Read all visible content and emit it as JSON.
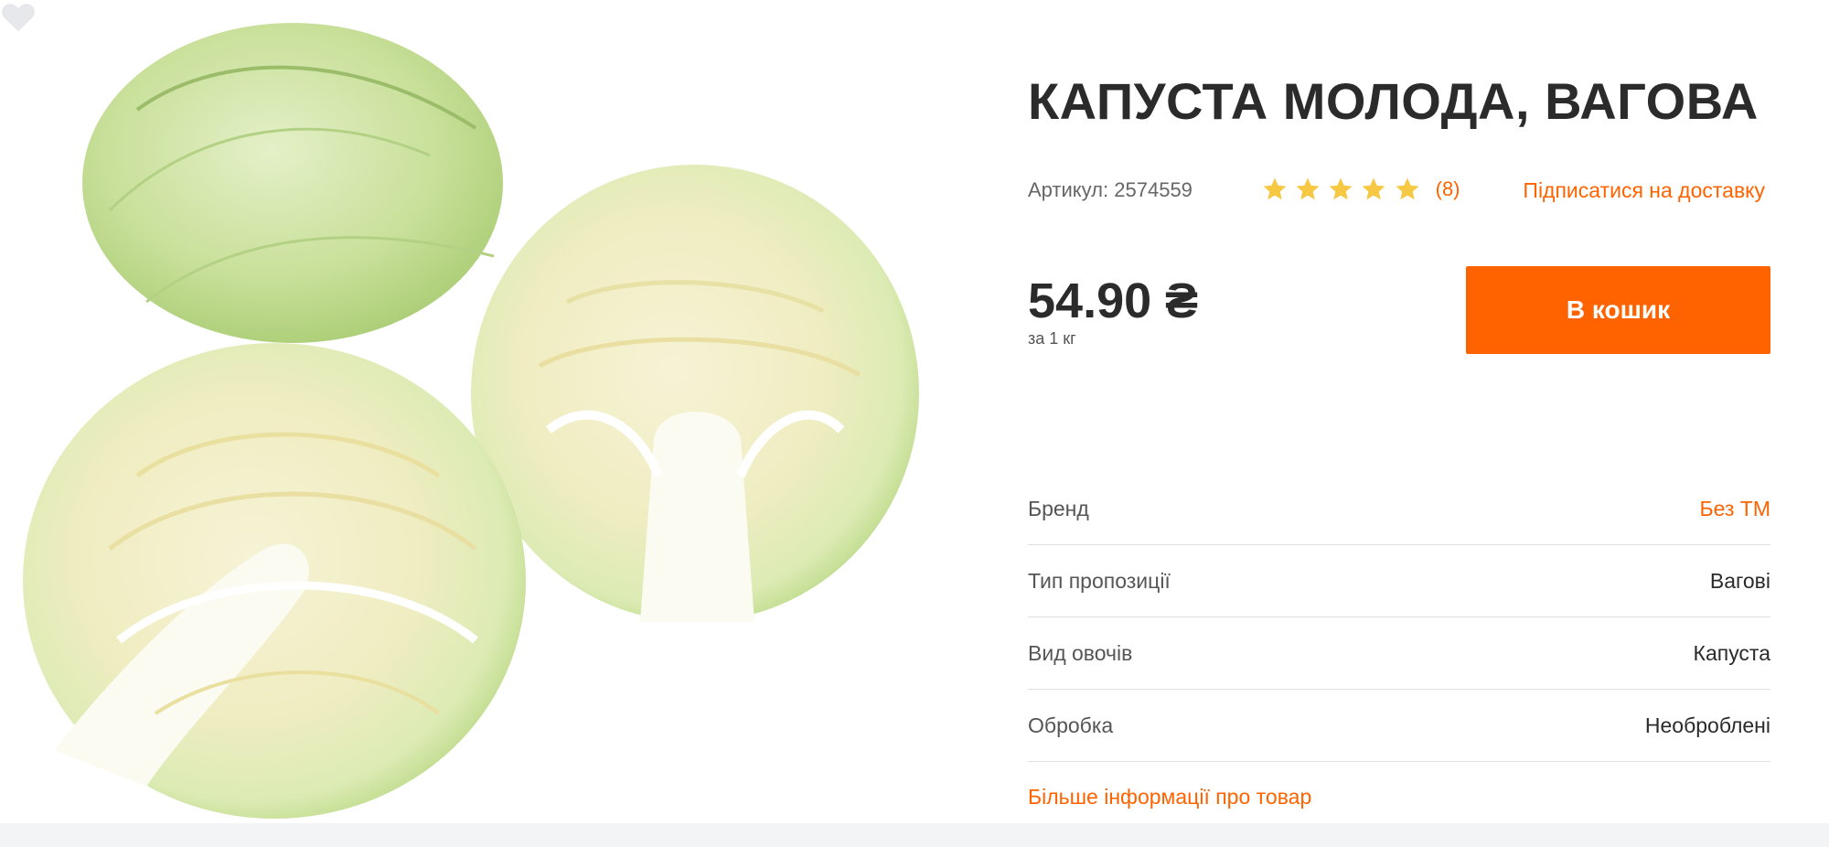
{
  "product": {
    "title": "КАПУСТА МОЛОДА, ВАГОВА",
    "sku_label": "Артикул:",
    "sku_value": "2574559",
    "rating_stars": 5,
    "rating_count": "(8)",
    "subscribe_label": "Підписатися на доставку",
    "price": "54.90 ₴",
    "price_unit": "за 1 кг",
    "cart_button": "В кошик",
    "image_alt": "cabbage-photo"
  },
  "properties": [
    {
      "key": "Бренд",
      "value": "Без ТМ",
      "is_link": true
    },
    {
      "key": "Тип пропозиції",
      "value": "Вагові",
      "is_link": false
    },
    {
      "key": "Вид овочів",
      "value": "Капуста",
      "is_link": false
    },
    {
      "key": "Обробка",
      "value": "Необроблені",
      "is_link": false
    }
  ],
  "more_info_label": "Більше інформації про товар",
  "colors": {
    "accent": "#ff6300",
    "star": "#f7c843",
    "text": "#2b2b2b",
    "muted": "#666666",
    "divider": "#e0e0e0"
  },
  "icons": {
    "favorite": "heart-icon",
    "rating": "star-icon"
  }
}
